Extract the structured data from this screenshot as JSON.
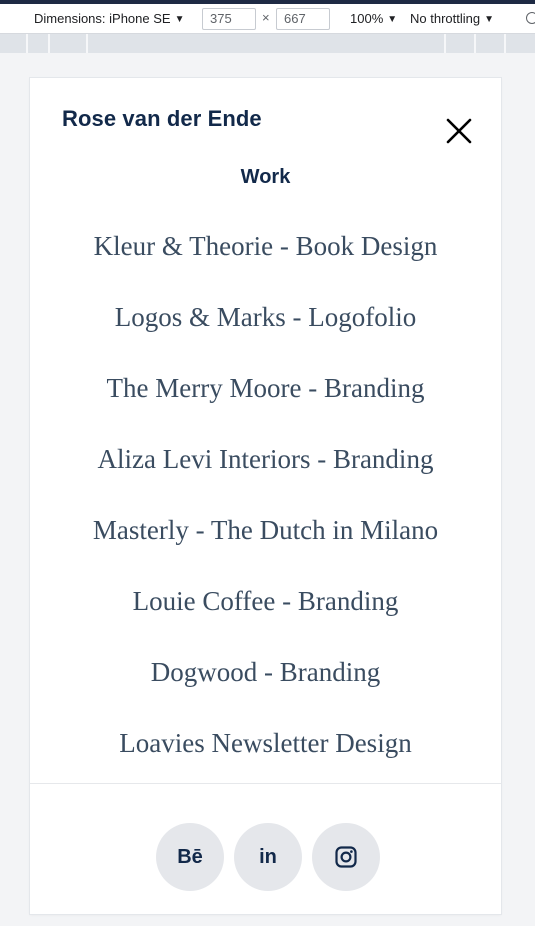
{
  "devtools": {
    "device_label": "Dimensions: iPhone SE",
    "width_value": "375",
    "height_value": "667",
    "times": "×",
    "zoom_label": "100%",
    "throttling_label": "No throttling",
    "caret": "▼"
  },
  "header": {
    "brand": "Rose van der Ende",
    "close_icon": "close-icon"
  },
  "menu": {
    "section_title": "Work",
    "items": [
      {
        "label": "Kleur & Theorie - Book Design"
      },
      {
        "label": "Logos & Marks - Logofolio"
      },
      {
        "label": "The Merry Moore - Branding"
      },
      {
        "label": "Aliza Levi Interiors - Branding"
      },
      {
        "label": "Masterly - The Dutch in Milano"
      },
      {
        "label": "Louie Coffee - Branding"
      },
      {
        "label": "Dogwood - Branding"
      },
      {
        "label": "Loavies Newsletter Design"
      }
    ]
  },
  "social": {
    "behance_text": "Bē",
    "linkedin_text": "in",
    "instagram_icon": "instagram-icon"
  },
  "colors": {
    "brand": "#12294a",
    "menu_text": "#3a4c60",
    "social_bg": "#e5e7eb",
    "page_bg": "#f3f4f6"
  }
}
